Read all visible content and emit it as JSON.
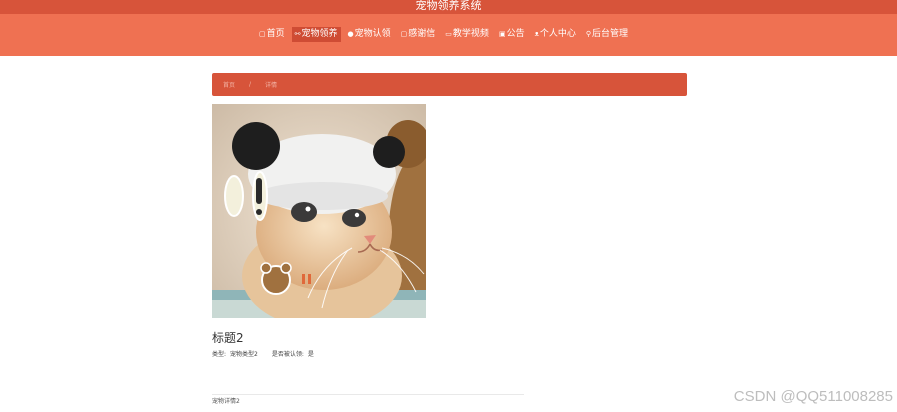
{
  "app": {
    "title": "宠物领养系统"
  },
  "nav": {
    "items": [
      {
        "icon": "home-icon",
        "glyph": "▢",
        "label": "首页"
      },
      {
        "icon": "link-icon",
        "glyph": "⚯",
        "label": "宠物领养",
        "active": true
      },
      {
        "icon": "paw-icon",
        "glyph": "●",
        "label": "宠物认领"
      },
      {
        "icon": "letter-icon",
        "glyph": "▢",
        "label": "感谢信"
      },
      {
        "icon": "video-icon",
        "glyph": "▭",
        "label": "教学视频"
      },
      {
        "icon": "notice-icon",
        "glyph": "▣",
        "label": "公告"
      },
      {
        "icon": "user-icon",
        "glyph": "ᴥ",
        "label": "个人中心"
      },
      {
        "icon": "admin-icon",
        "glyph": "⚲",
        "label": "后台管理"
      }
    ]
  },
  "breadcrumb": {
    "home": "首页",
    "separator": "/",
    "current": "详情"
  },
  "pet": {
    "title": "标题2",
    "type_label": "类型:",
    "type_value": "宠物类型2",
    "claimed_label": "是否被认领:",
    "claimed_value": "是"
  },
  "detail": {
    "tab_label": "宠物详情2"
  },
  "watermark": "CSDN @QQ511008285",
  "colors": {
    "topbar": "#d7543a",
    "navbar": "#ef7152",
    "nav_active": "#cf4c34"
  }
}
